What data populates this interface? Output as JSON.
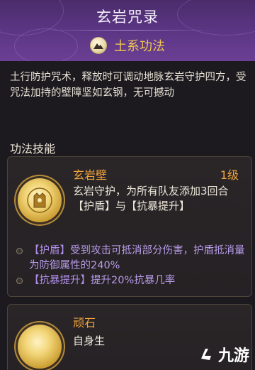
{
  "header": {
    "title": "玄岩咒录",
    "school_label": "土系功法",
    "school_icon": "mountain-icon"
  },
  "description": "土行防护咒术，释放时可调动地脉玄岩守护四方，受咒法加持的壁障坚如玄钢，无可撼动",
  "section_title": "功法技能",
  "skills": [
    {
      "name": "玄岩壁",
      "level": "1级",
      "text": "玄岩守护，为所有队友添加3回合【护盾】与【抗暴提升】",
      "effects": [
        {
          "tag": "【护盾】",
          "text": "受到攻击可抵消部分伤害，护盾抵消量为防御属性的240%"
        },
        {
          "tag": "【抗暴提升】",
          "text": "提升20%抗暴几率"
        }
      ]
    },
    {
      "name": "顽石",
      "text": "自身生"
    }
  ],
  "watermark": {
    "text": "九游",
    "icon": "jiuyou-logo-icon"
  },
  "colors": {
    "accent": "#f0a33c",
    "effect": "#b79ae8",
    "header": "#5d3786"
  }
}
